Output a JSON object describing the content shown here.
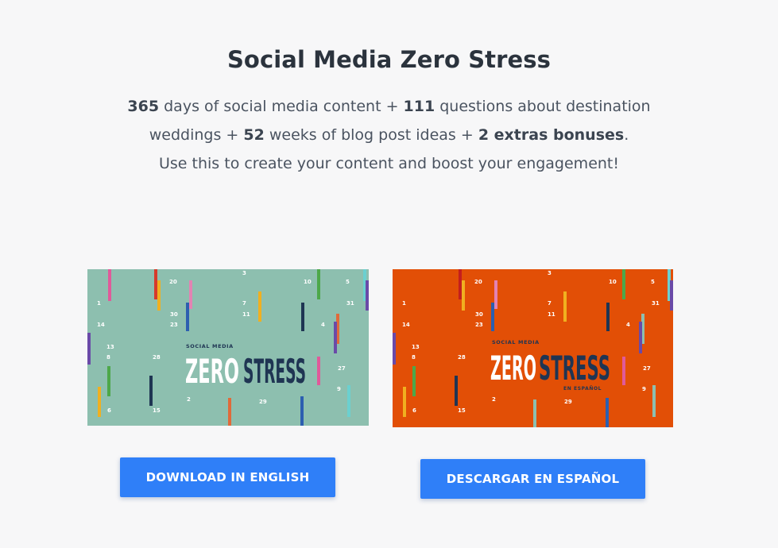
{
  "page": {
    "title": "Social Media Zero Stress",
    "description": {
      "line1": [
        {
          "text": "365",
          "bold": true
        },
        {
          "text": " days of social media content + ",
          "bold": false
        },
        {
          "text": "111",
          "bold": true
        },
        {
          "text": " questions about destination",
          "bold": false
        }
      ],
      "line2": [
        {
          "text": "weddings + ",
          "bold": false
        },
        {
          "text": "52",
          "bold": true
        },
        {
          "text": " weeks of blog post ideas + ",
          "bold": false
        },
        {
          "text": "2 extras bonuses",
          "bold": true
        },
        {
          "text": ".",
          "bold": false
        }
      ],
      "line3": [
        {
          "text": "Use this to create your content and boost your engagement!",
          "bold": false
        }
      ]
    }
  },
  "banners": {
    "english": {
      "small_title": "SOCIAL MEDIA",
      "zero": "ZERO",
      "stress": "STRESS",
      "subtitle": "",
      "numbers": [
        "20",
        "3",
        "10",
        "5",
        "1",
        "7",
        "31",
        "30",
        "11",
        "14",
        "23",
        "4",
        "13",
        "8",
        "28",
        "27",
        "9",
        "2",
        "29",
        "6",
        "15"
      ],
      "bg_color": "#8dbfaf"
    },
    "spanish": {
      "small_title": "SOCIAL MEDIA",
      "zero": "ZERO",
      "stress": "STRESS",
      "subtitle": "EN ESPAÑOL",
      "numbers": [
        "20",
        "3",
        "10",
        "5",
        "1",
        "7",
        "31",
        "30",
        "11",
        "14",
        "23",
        "4",
        "13",
        "8",
        "28",
        "27",
        "9",
        "2",
        "29",
        "6",
        "15"
      ],
      "bg_color": "#e24f06"
    }
  },
  "buttons": {
    "english": "DOWNLOAD IN ENGLISH",
    "spanish": "DESCARGAR EN ESPAÑOL"
  },
  "colors": {
    "accent": "#2f7ff8",
    "title": "#2b333d",
    "navy": "#1f3553"
  }
}
